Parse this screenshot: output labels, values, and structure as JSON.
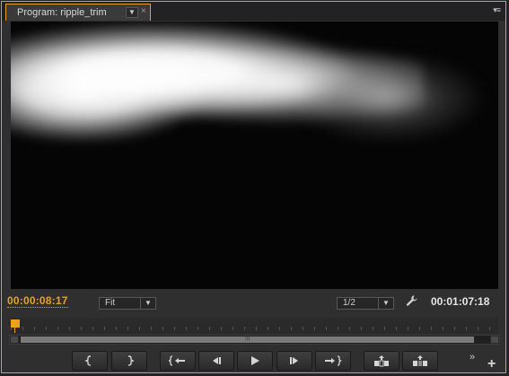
{
  "panel": {
    "tab_title": "Program: ripple_trim",
    "tab_menu_icon": "chevron-down-icon",
    "tab_close_icon": "close-icon",
    "panel_menu_icon": "panel-menu-icon",
    "accent_color": "#e2a21f"
  },
  "controls": {
    "current_time": "00:00:08:17",
    "zoom": "Fit",
    "resolution": "1/2",
    "settings_icon": "wrench-icon",
    "duration": "00:01:07:18"
  },
  "transport": {
    "buttons": [
      {
        "name": "mark-in-button",
        "icon": "mark-in-icon"
      },
      {
        "name": "mark-out-button",
        "icon": "mark-out-icon"
      },
      {
        "name": "go-to-in-button",
        "icon": "go-to-in-icon"
      },
      {
        "name": "step-back-button",
        "icon": "step-back-icon"
      },
      {
        "name": "play-button",
        "icon": "play-icon"
      },
      {
        "name": "step-forward-button",
        "icon": "step-forward-icon"
      },
      {
        "name": "go-to-out-button",
        "icon": "go-to-out-icon"
      },
      {
        "name": "lift-button",
        "icon": "lift-icon"
      },
      {
        "name": "extract-button",
        "icon": "extract-icon"
      }
    ],
    "more_icon": "double-chevron-right-icon",
    "add_icon": "plus-icon"
  }
}
